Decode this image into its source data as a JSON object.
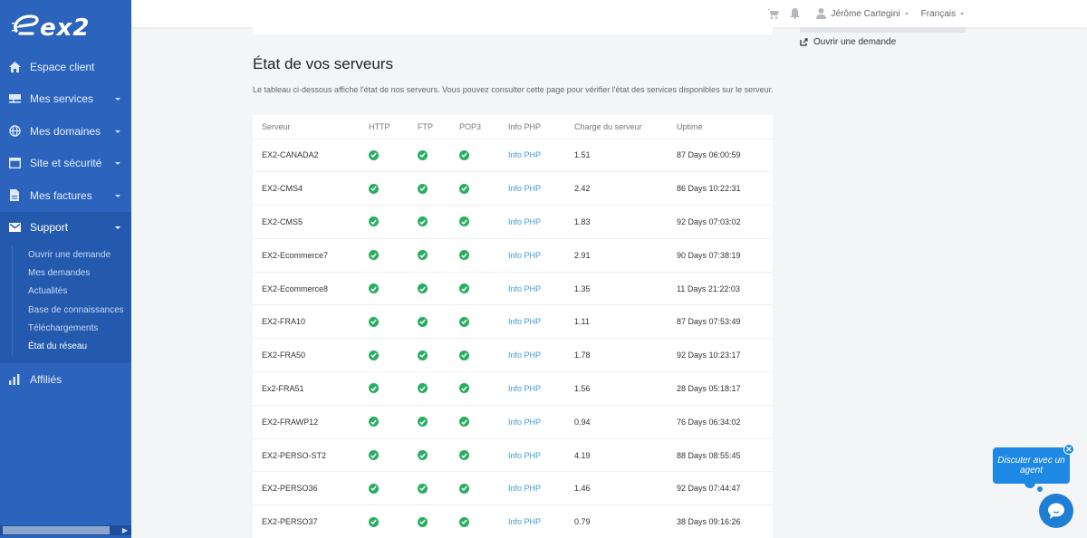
{
  "brand": {
    "logo_text": "ex2",
    "sidebar_color": "#2b63bd",
    "accent": "#1e88e5",
    "success": "#27ae60",
    "link": "#3d9bd6"
  },
  "sidebar": {
    "items": [
      {
        "label": "Espace client",
        "icon": "home-icon",
        "has_caret": false
      },
      {
        "label": "Mes services",
        "icon": "server-icon",
        "has_caret": true
      },
      {
        "label": "Mes domaines",
        "icon": "globe-icon",
        "has_caret": true
      },
      {
        "label": "Site et sécurité",
        "icon": "browser-window-icon",
        "has_caret": true
      },
      {
        "label": "Mes factures",
        "icon": "document-icon",
        "has_caret": true
      },
      {
        "label": "Support",
        "icon": "envelope-icon",
        "has_caret": true,
        "active": true
      },
      {
        "label": "Affiliés",
        "icon": "bar-chart-icon",
        "has_caret": false
      }
    ],
    "support_submenu": [
      {
        "label": "Ouvrir une demande"
      },
      {
        "label": "Mes demandes"
      },
      {
        "label": "Actualités"
      },
      {
        "label": "Base de connaissances"
      },
      {
        "label": "Téléchargements"
      },
      {
        "label": "État du réseau",
        "current": true
      }
    ]
  },
  "topbar": {
    "cart_icon": "cart-icon",
    "bell_icon": "bell-icon",
    "user_name": "Jérôme Cartegini",
    "language": "Français"
  },
  "side_panel": {
    "open_request_label": "Ouvrir une demande"
  },
  "main": {
    "title": "État de vos serveurs",
    "description": "Le tableau ci-dessous affiche l'état de nos serveurs. Vous pouvez consulter cette page pour vérifier l'état des services disponibles sur le serveur.",
    "table": {
      "columns": [
        "Serveur",
        "HTTP",
        "FTP",
        "POP3",
        "Info PHP",
        "Charge du serveur",
        "Uptime"
      ],
      "rows": [
        {
          "server": "EX2-CANADA2",
          "http": "ok",
          "ftp": "ok",
          "pop3": "ok",
          "php": "Info PHP",
          "load": "1.51",
          "uptime": "87 Days 06:00:59"
        },
        {
          "server": "EX2-CMS4",
          "http": "ok",
          "ftp": "ok",
          "pop3": "ok",
          "php": "Info PHP",
          "load": "2.42",
          "uptime": "86 Days 10:22:31"
        },
        {
          "server": "EX2-CMS5",
          "http": "ok",
          "ftp": "ok",
          "pop3": "ok",
          "php": "Info PHP",
          "load": "1.83",
          "uptime": "92 Days 07:03:02"
        },
        {
          "server": "EX2-Ecommerce7",
          "http": "ok",
          "ftp": "ok",
          "pop3": "ok",
          "php": "Info PHP",
          "load": "2.91",
          "uptime": "90 Days 07:38:19"
        },
        {
          "server": "EX2-Ecommerce8",
          "http": "ok",
          "ftp": "ok",
          "pop3": "ok",
          "php": "Info PHP",
          "load": "1.35",
          "uptime": "11 Days 21:22:03"
        },
        {
          "server": "EX2-FRA10",
          "http": "ok",
          "ftp": "ok",
          "pop3": "ok",
          "php": "Info PHP",
          "load": "1.11",
          "uptime": "87 Days 07:53:49"
        },
        {
          "server": "EX2-FRA50",
          "http": "ok",
          "ftp": "ok",
          "pop3": "ok",
          "php": "Info PHP",
          "load": "1.78",
          "uptime": "92 Days 10:23:17"
        },
        {
          "server": "Ex2-FRA51",
          "http": "ok",
          "ftp": "ok",
          "pop3": "ok",
          "php": "Info PHP",
          "load": "1.56",
          "uptime": "28 Days 05:18:17"
        },
        {
          "server": "EX2-FRAWP12",
          "http": "ok",
          "ftp": "ok",
          "pop3": "ok",
          "php": "Info PHP",
          "load": "0.94",
          "uptime": "76 Days 06:34:02"
        },
        {
          "server": "EX2-PERSO-ST2",
          "http": "ok",
          "ftp": "ok",
          "pop3": "ok",
          "php": "Info PHP",
          "load": "4.19",
          "uptime": "88 Days 08:55:45"
        },
        {
          "server": "EX2-PERSO36",
          "http": "ok",
          "ftp": "ok",
          "pop3": "ok",
          "php": "Info PHP",
          "load": "1.46",
          "uptime": "92 Days 07:44:47"
        },
        {
          "server": "EX2-PERSO37",
          "http": "ok",
          "ftp": "ok",
          "pop3": "ok",
          "php": "Info PHP",
          "load": "0.79",
          "uptime": "38 Days 09:16:26"
        }
      ]
    }
  },
  "chat": {
    "bubble_text": "Discuter avec un agent",
    "close_label": "✕"
  }
}
